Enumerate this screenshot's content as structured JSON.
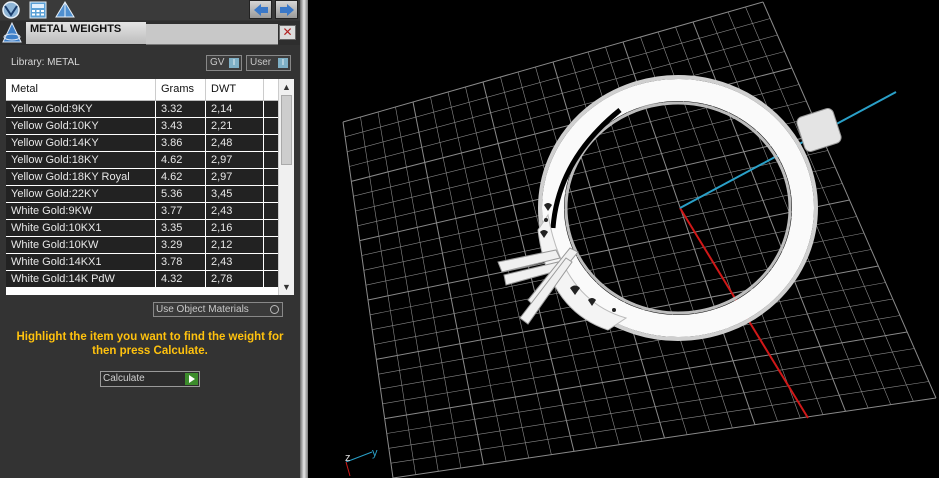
{
  "panel": {
    "title": "METAL WEIGHTS",
    "library_label": "Library: METAL",
    "toggles": [
      {
        "label": "GV",
        "state": "I"
      },
      {
        "label": "User",
        "state": "I"
      }
    ],
    "columns": [
      "Metal",
      "Grams",
      "DWT"
    ],
    "rows": [
      {
        "metal": "Yellow Gold:9KY",
        "grams": "3.32",
        "dwt": "2,14"
      },
      {
        "metal": "Yellow Gold:10KY",
        "grams": "3.43",
        "dwt": "2,21"
      },
      {
        "metal": "Yellow Gold:14KY",
        "grams": "3.86",
        "dwt": "2,48"
      },
      {
        "metal": "Yellow Gold:18KY",
        "grams": "4.62",
        "dwt": "2,97"
      },
      {
        "metal": "Yellow Gold:18KY Royal",
        "grams": "4.62",
        "dwt": "2,97"
      },
      {
        "metal": "Yellow Gold:22KY",
        "grams": "5.36",
        "dwt": "3,45"
      },
      {
        "metal": "White Gold:9KW",
        "grams": "3.77",
        "dwt": "2,43"
      },
      {
        "metal": "White Gold:10KX1",
        "grams": "3.35",
        "dwt": "2,16"
      },
      {
        "metal": "White Gold:10KW",
        "grams": "3.29",
        "dwt": "2,12"
      },
      {
        "metal": "White Gold:14KX1",
        "grams": "3.78",
        "dwt": "2,43"
      },
      {
        "metal": "White Gold:14K PdW",
        "grams": "4.32",
        "dwt": "2,78"
      }
    ],
    "use_object_materials": "Use Object Materials",
    "instruction": "Highlight the item you want to find the weight for then press Calculate.",
    "calculate_label": "Calculate"
  },
  "viewport": {
    "axis_z": "z",
    "axis_y": "y",
    "colors": {
      "grid": "#8a8a8a",
      "axis_x": "#d01818",
      "axis_y": "#2aa0c8",
      "ring": "#f2f2f2"
    }
  },
  "icons": [
    "viewport-sphere-icon",
    "calculator-icon",
    "pyramid-icon",
    "back-arrow-icon",
    "forward-arrow-icon",
    "close-icon"
  ]
}
